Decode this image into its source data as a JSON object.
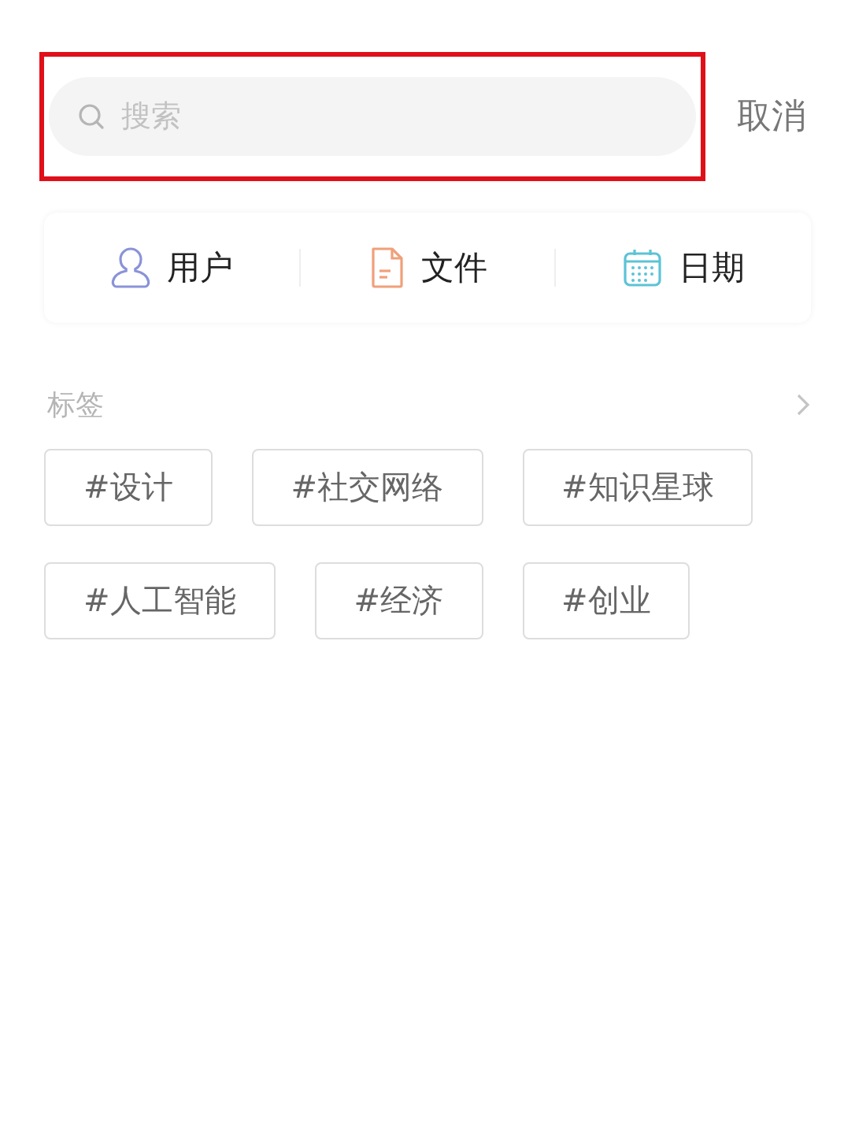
{
  "search": {
    "placeholder": "搜索",
    "highlighted": true
  },
  "cancel": "取消",
  "categories": [
    {
      "kind": "user",
      "label": "用户"
    },
    {
      "kind": "file",
      "label": "文件"
    },
    {
      "kind": "calendar",
      "label": "日期"
    }
  ],
  "tags_section": {
    "title": "标签",
    "tags": [
      "#设计",
      "#社交网络",
      "#知识星球",
      "#人工智能",
      "#经济",
      "#创业"
    ]
  }
}
